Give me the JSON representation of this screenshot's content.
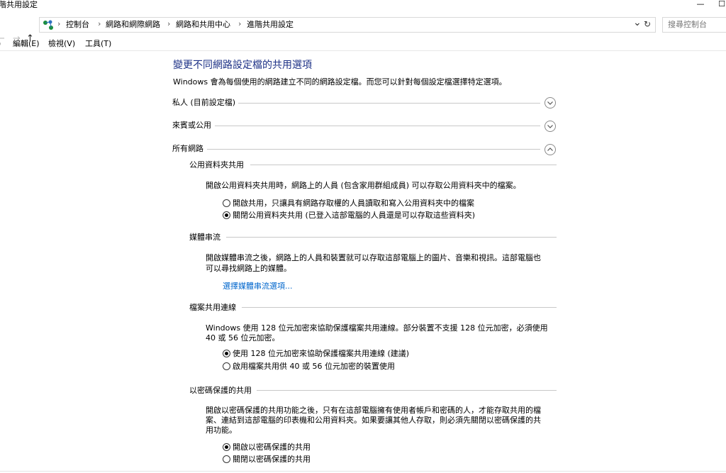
{
  "window": {
    "title": "階共用設定",
    "minimize_glyph": "—",
    "maximize_glyph": "☐"
  },
  "nav": {
    "back_glyph": "←",
    "forward_glyph": "→",
    "up_glyph": "↑",
    "separator_glyph": "›",
    "breadcrumbs": [
      "控制台",
      "網路和網際網路",
      "網路和共用中心",
      "進階共用設定"
    ],
    "dropdown_glyph": "⌄",
    "refresh_glyph": "↻",
    "search_placeholder": "搜尋控制台"
  },
  "menu": {
    "items": [
      "編輯(E)",
      "檢視(V)",
      "工具(T)"
    ],
    "partial_glyph": ")"
  },
  "content": {
    "title": "變更不同網路設定檔的共用選項",
    "intro": "Windows 會為每個使用的網路建立不同的網路設定檔。而您可以針對每個設定檔選擇特定選項。",
    "profiles": [
      {
        "label": "私人 (目前設定檔)",
        "expanded": false
      },
      {
        "label": "來賓或公用",
        "expanded": false
      },
      {
        "label": "所有網路",
        "expanded": true
      }
    ],
    "sections": {
      "public_folder": {
        "header": "公用資料夾共用",
        "desc": "開啟公用資料夾共用時，網路上的人員 (包含家用群組成員) 可以存取公用資料夾中的檔案。",
        "options": [
          {
            "label": "開啟共用，只讓具有網路存取權的人員讀取和寫入公用資料夾中的檔案",
            "selected": false
          },
          {
            "label": "關閉公用資料夾共用 (已登入這部電腦的人員還是可以存取這些資料夾)",
            "selected": true
          }
        ]
      },
      "media": {
        "header": "媒體串流",
        "desc_lines": [
          "開啟媒體串流之後，網路上的人員和裝置就可以存取這部電腦上的圖片、音樂和視訊。這部電腦也",
          "可以尋找網路上的媒體。"
        ],
        "link": "選擇媒體串流選項..."
      },
      "file_sharing": {
        "header": "檔案共用連線",
        "desc_lines": [
          "Windows 使用 128 位元加密來協助保護檔案共用連線。部分裝置不支援 128 位元加密，必須使用",
          "40 或 56 位元加密。"
        ],
        "options": [
          {
            "label": "使用 128 位元加密來協助保護檔案共用連線 (建議)",
            "selected": true
          },
          {
            "label": "啟用檔案共用供 40 或 56 位元加密的裝置使用",
            "selected": false
          }
        ]
      },
      "password": {
        "header": "以密碼保護的共用",
        "desc_lines": [
          "開啟以密碼保護的共用功能之後，只有在這部電腦擁有使用者帳戶和密碼的人，才能存取共用的檔",
          "案、連結到這部電腦的印表機和公用資料夾。如果要讓其他人存取，則必須先關閉以密碼保護的共",
          "用功能。"
        ],
        "options": [
          {
            "label": "開啟以密碼保護的共用",
            "selected": true
          },
          {
            "label": "關閉以密碼保護的共用",
            "selected": false
          }
        ]
      }
    }
  }
}
